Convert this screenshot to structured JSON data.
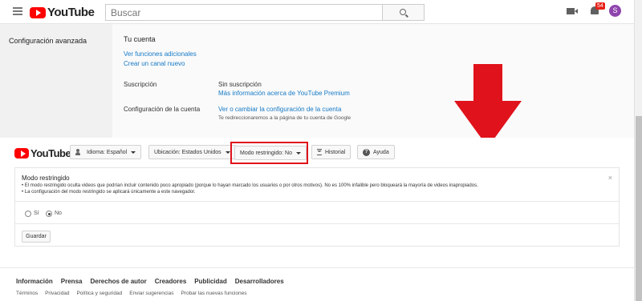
{
  "header": {
    "logo_text": "YouTube",
    "search_placeholder": "Buscar",
    "notifications_count": "54",
    "avatar_letter": "S"
  },
  "settings": {
    "nav_label": "Configuración avanzada",
    "account_heading": "Tu cuenta",
    "links": [
      "Ver funciones adicionales",
      "Crear un canal nuevo"
    ],
    "subscription_label": "Suscripción",
    "subscription_value": "Sin suscripción",
    "subscription_link": "Más información acerca de YouTube Premium",
    "account_config_label": "Configuración de la cuenta",
    "account_config_link": "Ver o cambiar la configuración de la cuenta",
    "account_config_note": "Te redireccionaremos a la página de tu cuenta de Google"
  },
  "bar": {
    "logo_text": "YouTube",
    "language": "Idioma: Español",
    "location": "Ubicación: Estados Unidos",
    "restricted_mode": "Modo restringido: No",
    "history": "Historial",
    "help": "Ayuda"
  },
  "restricted_panel": {
    "title": "Modo restringido",
    "bullets": [
      "• El modo restringido oculta videos que podrían incluir contenido poco apropiado (porque lo hayan marcado los usuarios o por otros motivos). No es 100% infalible pero bloqueará la mayoría de videos inapropiados.",
      "• La configuración del modo restringido se aplicará únicamente a este navegador."
    ],
    "close": "×",
    "option_yes": "Sí",
    "option_no": "No",
    "selected": "No",
    "save_label": "Guardar"
  },
  "footer": {
    "main_links": [
      "Información",
      "Prensa",
      "Derechos de autor",
      "Creadores",
      "Publicidad",
      "Desarrolladores"
    ],
    "sub_links": [
      "Términos",
      "Privacidad",
      "Política y seguridad",
      "Enviar sugerencias",
      "Probar las nuevas funciones"
    ]
  },
  "colors": {
    "brand": "#ff0000",
    "link": "#167ac6",
    "highlight": "#e0121b",
    "arrow": "#e0121b"
  }
}
